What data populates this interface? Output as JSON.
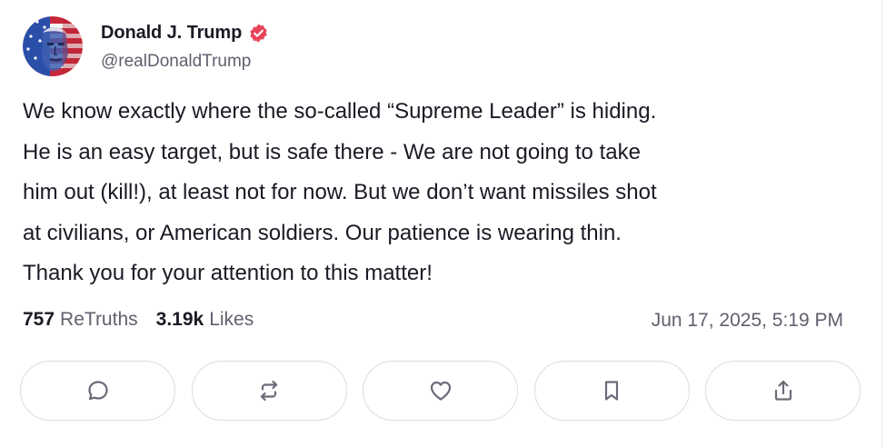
{
  "author": {
    "display_name": "Donald J. Trump",
    "handle": "@realDonaldTrump",
    "verified_color": "#e8435b"
  },
  "post": {
    "lines": [
      "We know exactly where the so-called “Supreme Leader” is hiding.",
      "He is an easy target, but is safe there - We are not going to take",
      "him out (kill!), at least not for now. But we don’t want missiles shot",
      "at civilians, or American soldiers. Our patience is wearing thin.",
      "Thank you for your attention to this matter!"
    ]
  },
  "stats": {
    "retruths_count": "757",
    "retruths_label": "ReTruths",
    "likes_count": "3.19k",
    "likes_label": "Likes"
  },
  "timestamp": "Jun 17, 2025, 5:19 PM",
  "actions": [
    {
      "icon": "reply-icon"
    },
    {
      "icon": "retruth-icon"
    },
    {
      "icon": "heart-icon"
    },
    {
      "icon": "bookmark-icon"
    },
    {
      "icon": "share-icon"
    }
  ],
  "colors": {
    "text": "#1a1a24",
    "muted": "#60606e",
    "border": "#dcdce4",
    "icon": "#6b6b78"
  }
}
